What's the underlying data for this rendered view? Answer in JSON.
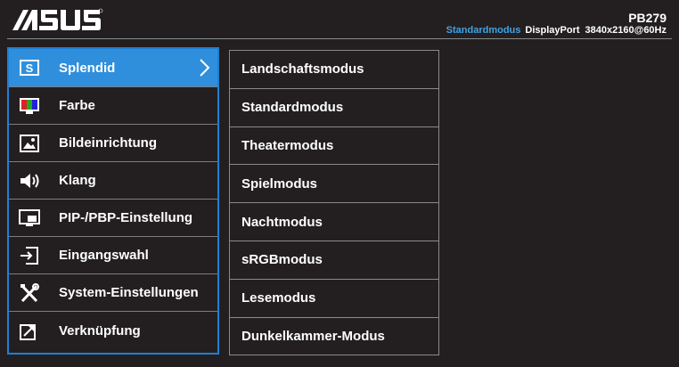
{
  "brand": {
    "logo_text": "/ISUS"
  },
  "header": {
    "model": "PB279",
    "mode": "Standardmodus",
    "input": "DisplayPort",
    "resolution": "3840x2160@60Hz"
  },
  "colors": {
    "accent": "#2f8fdc",
    "border_accent": "#1f7fd3",
    "mode_text": "#3fa3e6",
    "background": "#231f20"
  },
  "main_menu": {
    "items": [
      {
        "label": "Splendid",
        "icon": "splendid-icon"
      },
      {
        "label": "Farbe",
        "icon": "color-monitor-icon"
      },
      {
        "label": "Bildeinrichtung",
        "icon": "image-icon"
      },
      {
        "label": "Klang",
        "icon": "speaker-icon"
      },
      {
        "label": "PIP-/PBP-Einstellung",
        "icon": "pip-icon"
      },
      {
        "label": "Eingangswahl",
        "icon": "input-select-icon"
      },
      {
        "label": "System-Einstellungen",
        "icon": "tools-icon"
      },
      {
        "label": "Verknüpfung",
        "icon": "shortcut-icon"
      }
    ]
  },
  "sub_menu": {
    "items": [
      {
        "label": "Landschaftsmodus"
      },
      {
        "label": "Standardmodus"
      },
      {
        "label": "Theatermodus"
      },
      {
        "label": "Spielmodus"
      },
      {
        "label": "Nachtmodus"
      },
      {
        "label": "sRGBmodus"
      },
      {
        "label": "Lesemodus"
      },
      {
        "label": "Dunkelkammer-Modus"
      }
    ]
  }
}
